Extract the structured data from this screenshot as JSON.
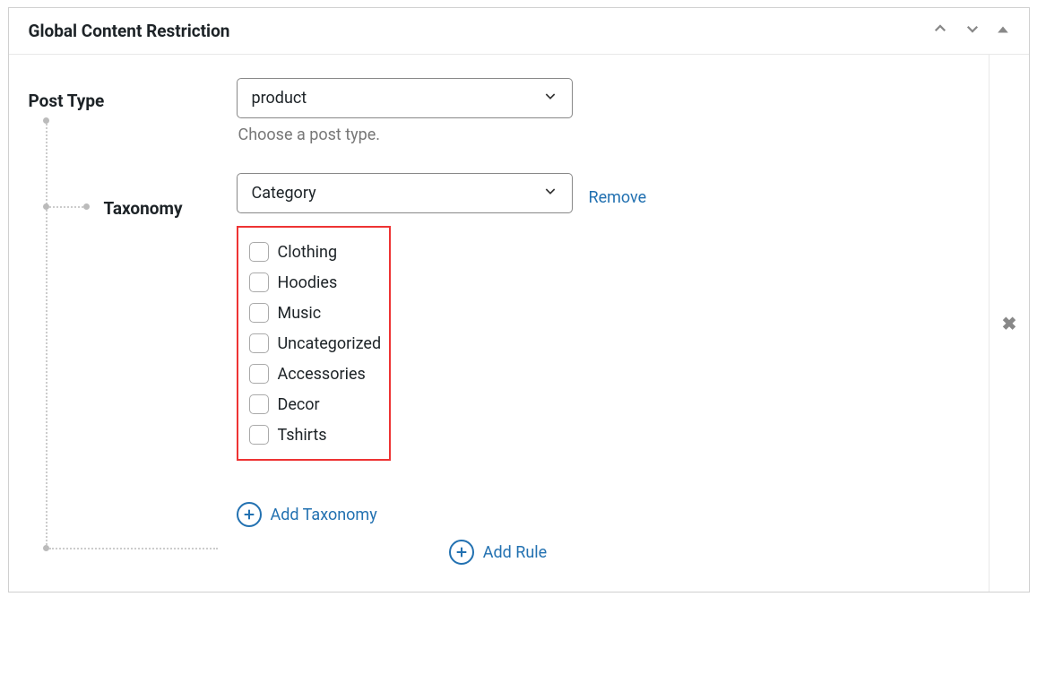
{
  "panel": {
    "title": "Global Content Restriction"
  },
  "postType": {
    "label": "Post Type",
    "value": "product",
    "hint": "Choose a post type."
  },
  "taxonomy": {
    "label": "Taxonomy",
    "value": "Category",
    "removeLabel": "Remove",
    "terms": [
      "Clothing",
      "Hoodies",
      "Music",
      "Uncategorized",
      "Accessories",
      "Decor",
      "Tshirts"
    ],
    "addLabel": "Add Taxonomy"
  },
  "rules": {
    "addLabel": "Add Rule"
  }
}
